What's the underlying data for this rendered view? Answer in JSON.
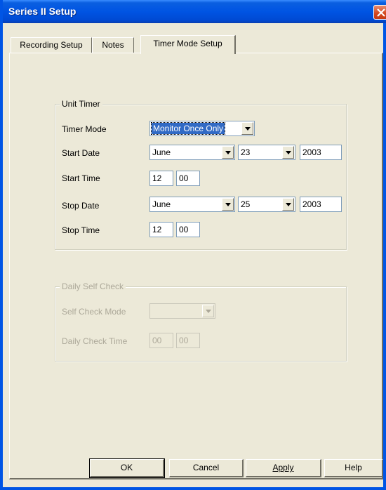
{
  "window": {
    "title": "Series II Setup"
  },
  "tabs": [
    {
      "label": "Recording Setup"
    },
    {
      "label": "Notes"
    },
    {
      "label": "Timer Mode Setup"
    }
  ],
  "unit_timer": {
    "title": "Unit Timer",
    "timer_mode_label": "Timer Mode",
    "timer_mode_value": "Monitor Once Only",
    "start_date_label": "Start Date",
    "start_month": "June",
    "start_day": "23",
    "start_year": "2003",
    "start_time_label": "Start Time",
    "start_hour": "12",
    "start_minute": "00",
    "stop_date_label": "Stop Date",
    "stop_month": "June",
    "stop_day": "25",
    "stop_year": "2003",
    "stop_time_label": "Stop Time",
    "stop_hour": "12",
    "stop_minute": "00"
  },
  "daily_self_check": {
    "title": "Daily Self Check",
    "mode_label": "Self Check Mode",
    "mode_value": "",
    "time_label": "Daily Check Time",
    "hour": "00",
    "minute": "00"
  },
  "buttons": {
    "ok": "OK",
    "cancel": "Cancel",
    "apply": "Apply",
    "help": "Help"
  }
}
